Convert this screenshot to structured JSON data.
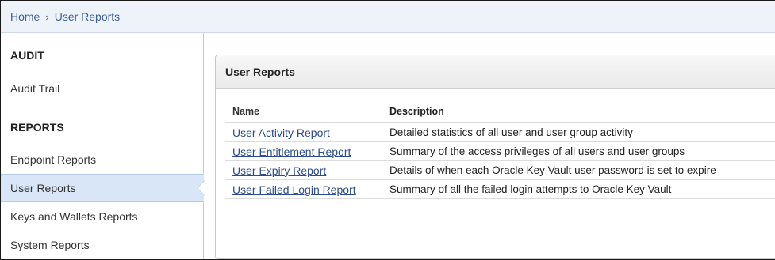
{
  "breadcrumb": {
    "home": "Home",
    "separator": "›",
    "current": "User Reports"
  },
  "sidebar": {
    "sections": [
      {
        "heading": "AUDIT",
        "items": [
          "Audit Trail"
        ]
      },
      {
        "heading": "REPORTS",
        "items": [
          "Endpoint Reports",
          "User Reports",
          "Keys and Wallets Reports",
          "System Reports"
        ]
      }
    ],
    "active_item": "User Reports"
  },
  "panel": {
    "title": "User Reports",
    "columns": {
      "name": "Name",
      "description": "Description"
    },
    "rows": [
      {
        "name": "User Activity Report",
        "description": "Detailed statistics of all user and user group activity"
      },
      {
        "name": "User Entitlement Report",
        "description": "Summary of the access privileges of all users and user groups"
      },
      {
        "name": "User Expiry Report",
        "description": "Details of when each Oracle Key Vault user password is set to expire"
      },
      {
        "name": "User Failed Login Report",
        "description": "Summary of all the failed login attempts to Oracle Key Vault"
      }
    ]
  },
  "colors": {
    "link": "#2c4c8c",
    "active_bg": "#d8e6f7",
    "breadcrumb_bg": "#eef3fa"
  }
}
